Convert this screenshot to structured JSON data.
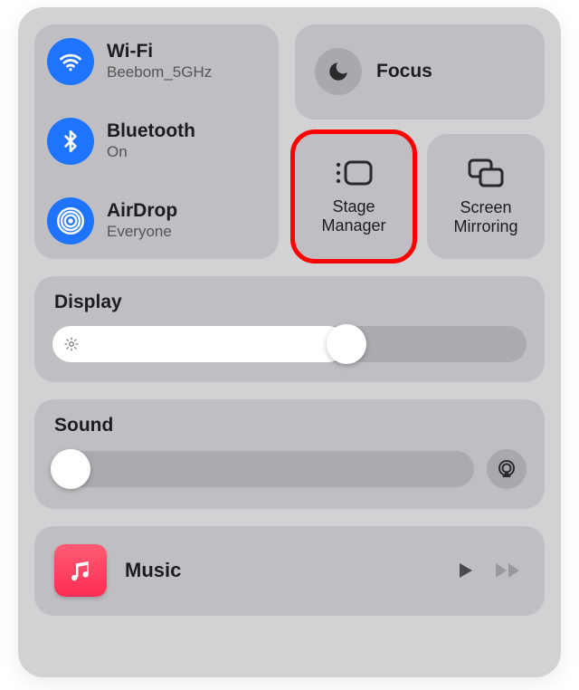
{
  "connectivity": {
    "wifi": {
      "title": "Wi-Fi",
      "subtitle": "Beebom_5GHz"
    },
    "bluetooth": {
      "title": "Bluetooth",
      "subtitle": "On"
    },
    "airdrop": {
      "title": "AirDrop",
      "subtitle": "Everyone"
    }
  },
  "focus": {
    "title": "Focus"
  },
  "stage_manager": {
    "label": "Stage\nManager"
  },
  "screen_mirroring": {
    "label": "Screen\nMirroring"
  },
  "display": {
    "title": "Display",
    "value_pct": 62
  },
  "sound": {
    "title": "Sound",
    "value_pct": 0
  },
  "media": {
    "app": "Music"
  },
  "colors": {
    "accent_blue": "#1e73ff",
    "highlight_red": "#ff0000"
  }
}
